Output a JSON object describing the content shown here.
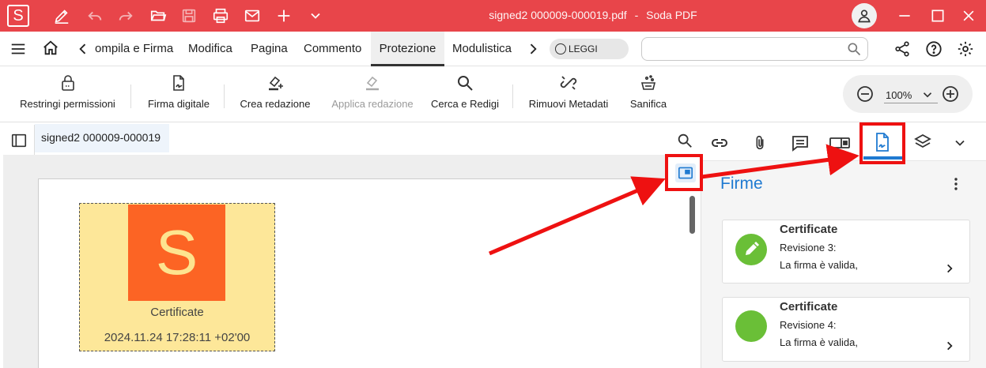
{
  "app": {
    "logo_letter": "S",
    "title": "signed2 000009-000019.pdf",
    "app_name": "Soda PDF",
    "title_separator": "-"
  },
  "menu": {
    "tabs": [
      {
        "label": "ompila e Firma"
      },
      {
        "label": "Modifica"
      },
      {
        "label": "Pagina"
      },
      {
        "label": "Commento"
      },
      {
        "label": "Protezione",
        "active": true
      },
      {
        "label": "Modulistica"
      }
    ],
    "read_mode_label": "LEGGI",
    "search_placeholder": ""
  },
  "ribbon": {
    "buttons": [
      {
        "label": "Restringi permissioni",
        "icon": "lock-icon"
      },
      {
        "label": "Firma digitale",
        "icon": "sign-document-icon"
      },
      {
        "label": "Crea redazione",
        "icon": "create-redaction-icon"
      },
      {
        "label": "Applica redazione",
        "icon": "apply-redaction-icon",
        "disabled": true
      },
      {
        "label": "Cerca e Redigi",
        "icon": "search-icon"
      },
      {
        "label": "Rimuovi Metadati",
        "icon": "remove-metadata-icon"
      },
      {
        "label": "Sanifica",
        "icon": "sanitize-icon"
      }
    ],
    "zoom": "100%"
  },
  "document": {
    "tab_label": "signed2 000009-000019",
    "signature": {
      "logo_letter": "S",
      "label": "Certificate",
      "date": "2024.11.24 17:28:11 +02'00"
    }
  },
  "panel": {
    "title": "Firme",
    "signatures": [
      {
        "name": "Certificate",
        "revision": "Revisione 3:",
        "status": "La firma è valida,",
        "icon": "pencil-icon"
      },
      {
        "name": "Certificate",
        "revision": "Revisione 4:",
        "status": "La firma è valida,",
        "icon": "none"
      }
    ]
  },
  "colors": {
    "titlebar": "#e8454a",
    "accent_blue": "#1f7ad1",
    "signature_bg": "#fde799",
    "logo_orange": "#fc6424",
    "valid_green": "#6abf37",
    "annotation_red": "#ee1111"
  }
}
